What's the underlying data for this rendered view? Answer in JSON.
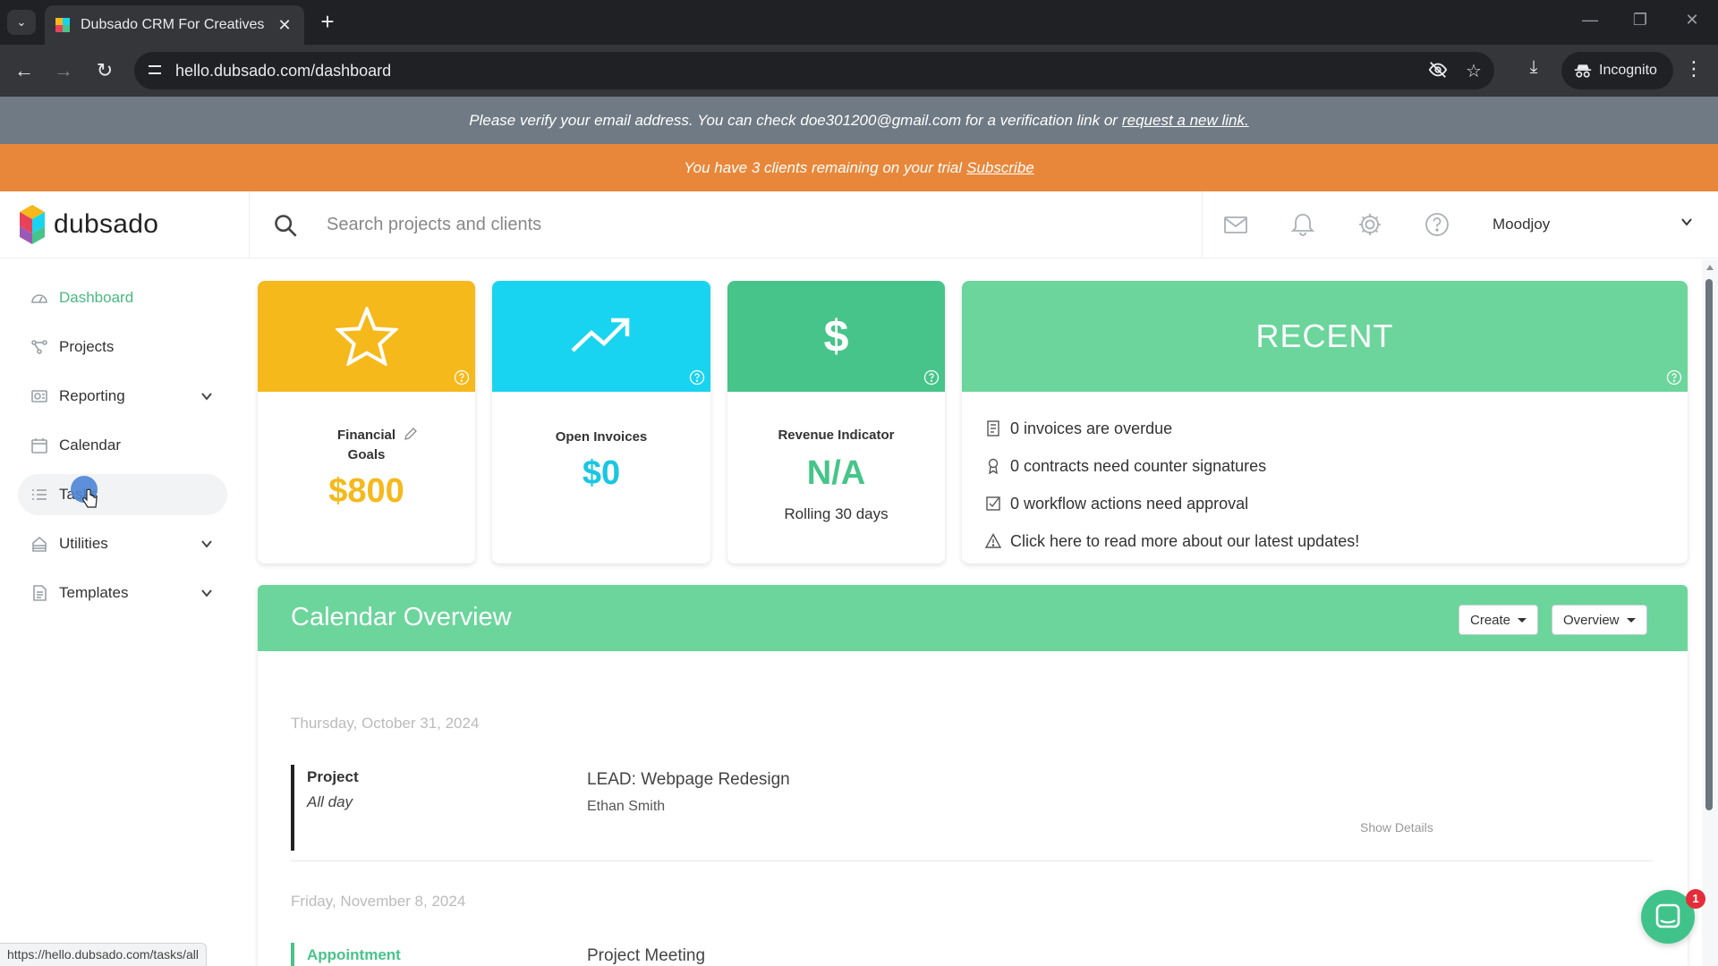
{
  "browser": {
    "tab_title": "Dubsado CRM For Creatives",
    "url": "hello.dubsado.com/dashboard",
    "incognito_label": "Incognito",
    "status_url": "https://hello.dubsado.com/tasks/all"
  },
  "banners": {
    "verify_text": "Please verify your email address. You can check doe301200@gmail.com for a verification link or",
    "verify_link": "request a new link.",
    "trial_text": "You have 3 clients remaining on your trial",
    "trial_link": "Subscribe"
  },
  "header": {
    "logo_text": "dubsado",
    "search_placeholder": "Search projects and clients",
    "user_name": "Moodjoy"
  },
  "sidebar": {
    "items": [
      {
        "label": "Dashboard",
        "icon": "dashboard-icon"
      },
      {
        "label": "Projects",
        "icon": "projects-icon"
      },
      {
        "label": "Reporting",
        "icon": "reporting-icon",
        "expandable": true
      },
      {
        "label": "Calendar",
        "icon": "calendar-icon"
      },
      {
        "label": "Tasks",
        "icon": "tasks-icon"
      },
      {
        "label": "Utilities",
        "icon": "utilities-icon",
        "expandable": true
      },
      {
        "label": "Templates",
        "icon": "templates-icon",
        "expandable": true
      }
    ]
  },
  "cards": {
    "financial": {
      "label_line1": "Financial",
      "label_line2": "Goals",
      "value": "$800",
      "color": "#f5b91b"
    },
    "invoices": {
      "label": "Open Invoices",
      "value": "$0",
      "color": "#19d4f0"
    },
    "revenue": {
      "label": "Revenue Indicator",
      "value": "N/A",
      "sub": "Rolling 30 days",
      "color": "#47c489"
    },
    "recent": {
      "title": "RECENT",
      "color": "#6bd59b",
      "rows": [
        "0 invoices are overdue",
        "0 contracts need counter signatures",
        "0 workflow actions need approval",
        "Click here to read more about our latest updates!"
      ]
    }
  },
  "calendar": {
    "title": "Calendar Overview",
    "create_label": "Create",
    "overview_label": "Overview",
    "events": [
      {
        "date": "Thursday, October 31, 2024",
        "type": "Project",
        "time": "All day",
        "title": "LEAD: Webpage Redesign",
        "client": "Ethan Smith",
        "details": "Show Details"
      },
      {
        "date": "Friday, November 8, 2024",
        "type": "Appointment",
        "title": "Project Meeting"
      }
    ]
  },
  "chat": {
    "badge": "1"
  }
}
